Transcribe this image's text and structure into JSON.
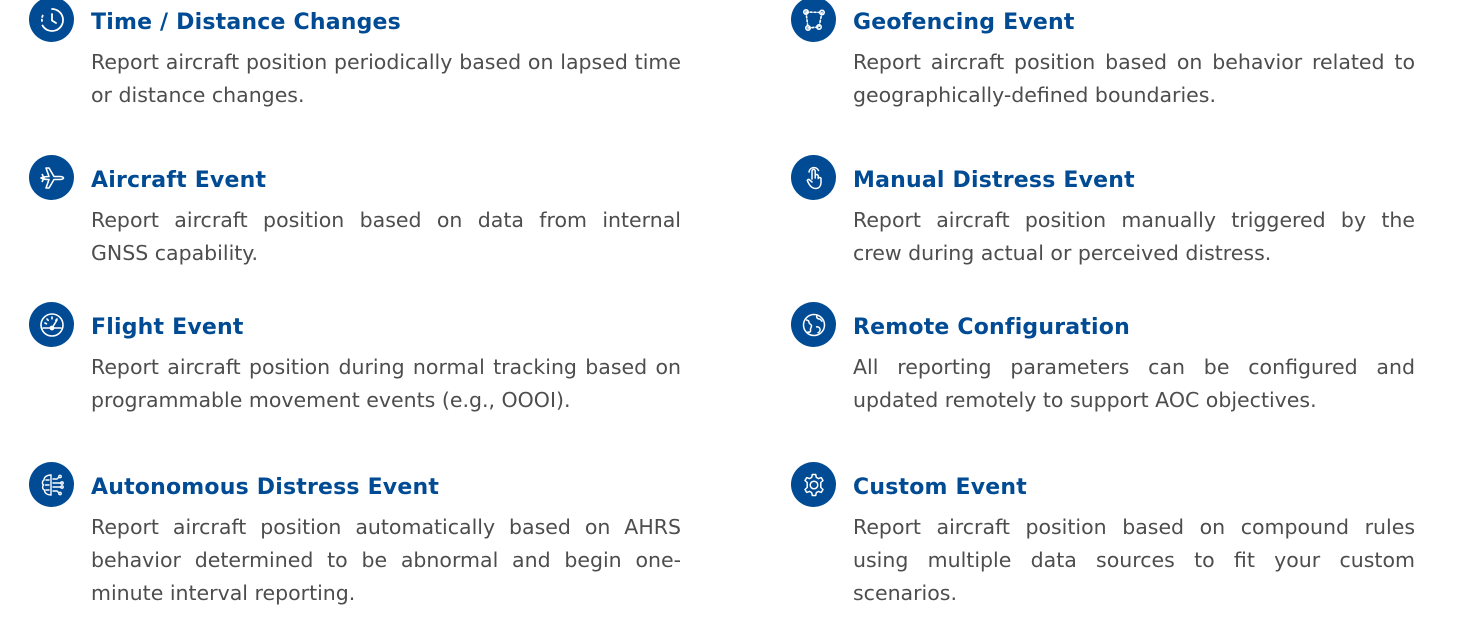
{
  "left": [
    {
      "icon": "clock-icon",
      "title": "Time / Distance Changes",
      "description": "Report aircraft position periodically based on lapsed time or distance changes."
    },
    {
      "icon": "airplane-icon",
      "title": "Aircraft Event",
      "description": "Report aircraft position based on data from internal GNSS capability."
    },
    {
      "icon": "speedometer-icon",
      "title": "Flight Event",
      "description": "Report aircraft position during normal tracking based on programmable movement events (e.g., OOOI)."
    },
    {
      "icon": "circuit-brain-icon",
      "title": "Autonomous Distress Event",
      "description": "Report aircraft position automatically based on AHRS behavior determined to be abnormal and begin one-minute interval reporting."
    }
  ],
  "right": [
    {
      "icon": "geofence-polygon-icon",
      "title": "Geofencing Event",
      "description": "Report aircraft position based on behavior related to geographically-defined boundaries."
    },
    {
      "icon": "hand-pointer-icon",
      "title": "Manual Distress Event",
      "description": "Report aircraft position manually triggered by the crew during actual or perceived distress."
    },
    {
      "icon": "globe-icon",
      "title": "Remote Configuration",
      "description": "All reporting parameters can be configured and updated remotely to support AOC  objectives."
    },
    {
      "icon": "gear-icon",
      "title": "Custom Event",
      "description": "Report aircraft position based on compound rules using multiple data sources to fit your custom scenarios."
    }
  ],
  "colors": {
    "accent": "#004B93",
    "text": "#4d4d4d",
    "background": "#ffffff"
  }
}
